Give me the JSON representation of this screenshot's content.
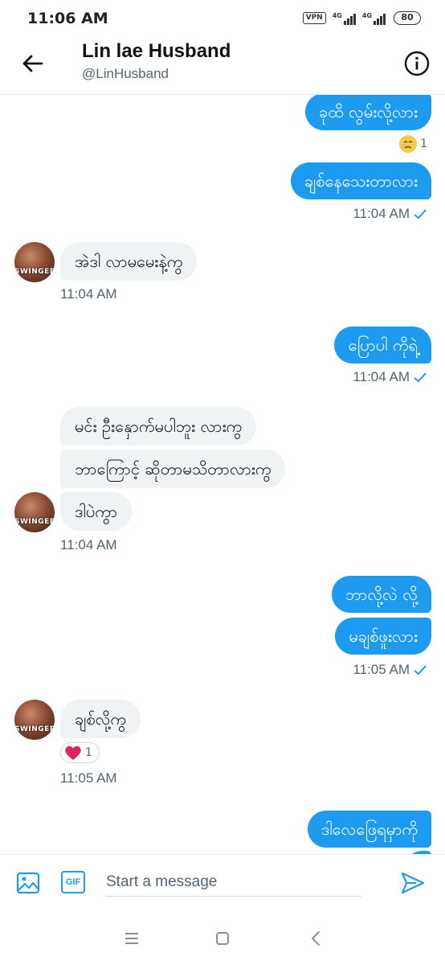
{
  "status_bar": {
    "time": "11:06 AM",
    "vpn": "VPN",
    "net1": "4G",
    "net2": "4G",
    "battery": "80"
  },
  "header": {
    "name": "Lin lae Husband",
    "handle": "@LinHusband"
  },
  "messages": [
    {
      "text": "ခုထိ လွမ်းလို့လား"
    },
    {
      "reaction_count": "1",
      "reaction_icon": "crying-face"
    },
    {
      "text": "ချစ်နေသေးတာလား"
    },
    {
      "timestamp": "11:04 AM"
    },
    {
      "text": "အဲဒါ လာမမေးနဲ့ကွ"
    },
    {
      "timestamp": "11:04 AM"
    },
    {
      "text": "ပြောပါ ကိုရဲ့"
    },
    {
      "timestamp": "11:04 AM"
    },
    {
      "text": "မင်း ဦးနှောက်မပါဘူး လားကွ"
    },
    {
      "text": "ဘာကြောင့် ဆိုတာမသိတာလားကွ"
    },
    {
      "text": "ဒါပဲကွာ"
    },
    {
      "timestamp": "11:04 AM"
    },
    {
      "text": "ဘာလို့လဲ လို့"
    },
    {
      "text": "မချစ်ဖူးလား"
    },
    {
      "timestamp": "11:05 AM"
    },
    {
      "text": "ချစ်လို့ကွ"
    },
    {
      "reaction_count": "1",
      "reaction_icon": "red-heart"
    },
    {
      "timestamp": "11:05 AM"
    },
    {
      "text": "ဒါလေဖြေရမှာကို"
    }
  ],
  "avatar_label": "SWINGER",
  "composer": {
    "placeholder": "Start a message",
    "gif_label": "GIF"
  },
  "colors": {
    "accent": "#1d9bf0",
    "incoming_bubble": "#eff3f4",
    "muted_text": "#536471"
  }
}
